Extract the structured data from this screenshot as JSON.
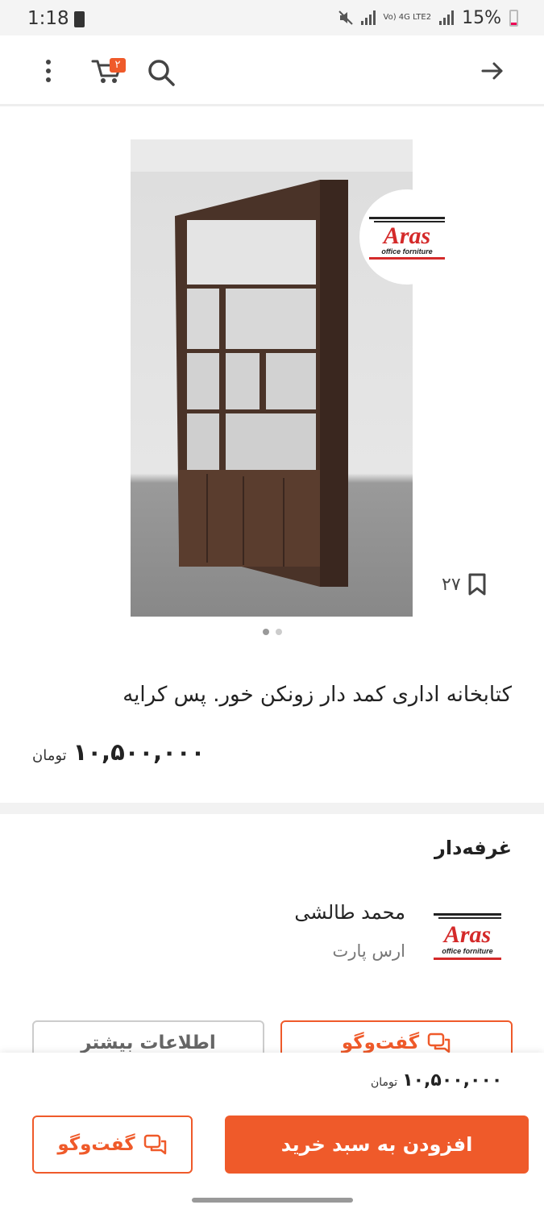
{
  "status_bar": {
    "time": "1:18",
    "network_label": "Vo) 4G LTE2",
    "battery_percent": "15%"
  },
  "app_bar": {
    "cart_count": "۲"
  },
  "gallery": {
    "logo_text": "Aras",
    "logo_subtext": "office forniture",
    "save_count": "۲۷",
    "image_count": 2,
    "active_image_index": 0
  },
  "product": {
    "title": "کتابخانه اداری کمد دار زونکن خور. پس کرایه",
    "price": "۱۰,۵۰۰,۰۰۰",
    "currency": "تومان"
  },
  "seller": {
    "section_title": "غرفه‌دار",
    "name": "محمد طالشی",
    "shop": "ارس پارت",
    "logo_text": "Aras",
    "logo_subtext": "office forniture"
  },
  "actions": {
    "chat_label": "گفت‌وگو",
    "more_info_label": "اطلاعات بیشتر",
    "add_to_cart_label": "افزودن به سبد خرید"
  },
  "bottom_bar": {
    "price": "۱۰,۵۰۰,۰۰۰",
    "currency": "تومان"
  },
  "colors": {
    "accent": "#ef5a2a",
    "logo_red": "#d42a2a"
  }
}
